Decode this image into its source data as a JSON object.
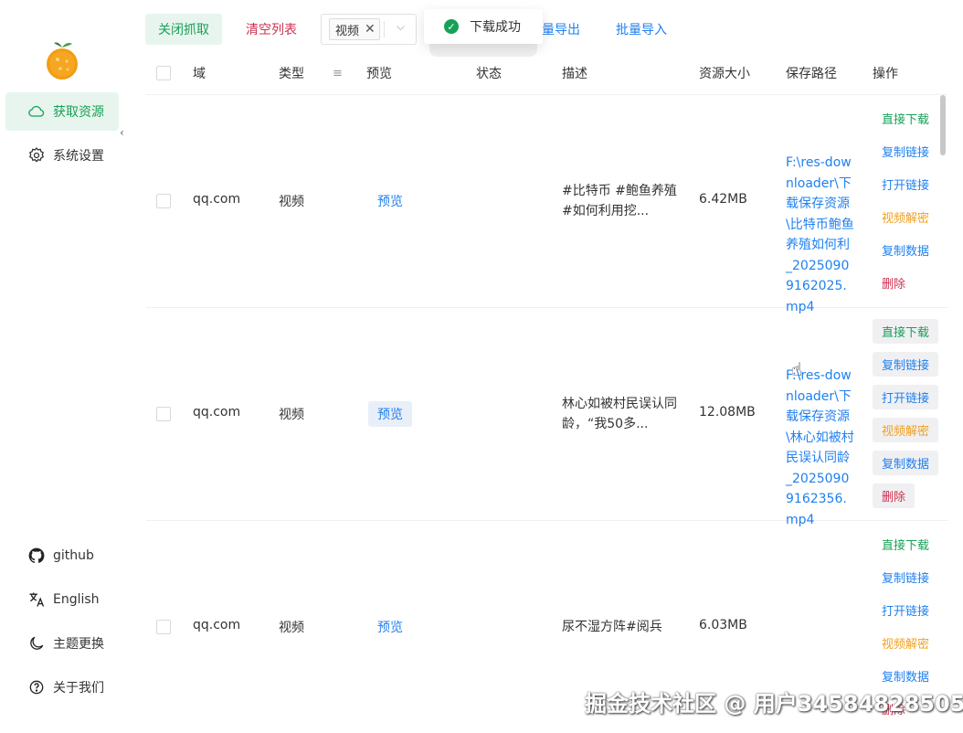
{
  "colors": {
    "accent": "#18a058",
    "link": "#2080f0",
    "warn": "#f0a020",
    "danger": "#d03050",
    "close": "#ff5f57",
    "min": "#febc2e",
    "max": "#28c840"
  },
  "sidebar": {
    "items": [
      {
        "label": "获取资源",
        "icon": "cloud-icon",
        "active": true
      },
      {
        "label": "系统设置",
        "icon": "gear-icon"
      }
    ],
    "bottom": [
      {
        "label": "github",
        "icon": "github-icon"
      },
      {
        "label": "English",
        "icon": "translate-icon"
      },
      {
        "label": "主题更换",
        "icon": "moon-icon"
      },
      {
        "label": "关于我们",
        "icon": "help-icon"
      }
    ]
  },
  "toolbar": {
    "close_capture": "关闭抓取",
    "clear_list": "清空列表",
    "filter_tag": "视频",
    "batch_export": "量导出",
    "batch_import": "批量导入"
  },
  "toast": {
    "text": "下载成功"
  },
  "table": {
    "headers": {
      "domain": "域",
      "type": "类型",
      "preview": "预览",
      "status": "状态",
      "desc": "描述",
      "size": "资源大小",
      "path": "保存路径",
      "ops": "操作"
    },
    "rows": [
      {
        "domain": "qq.com",
        "type": "视频",
        "preview": "预览",
        "desc": "#比特币 #鲍鱼养殖 #如何利用挖...",
        "size": "6.42MB",
        "path": "F:\\res-downloader\\下载保存资源\\比特币鲍鱼养殖如何利_20250909162025.mp4"
      },
      {
        "domain": "qq.com",
        "type": "视频",
        "preview": "预览",
        "desc": "林心如被村民误认同龄，“我50多...",
        "size": "12.08MB",
        "path": "F:\\res-downloader\\下载保存资源\\林心如被村民误认同龄_20250909162356.mp4"
      },
      {
        "domain": "qq.com",
        "type": "视频",
        "preview": "预览",
        "desc": "尿不湿方阵#阅兵",
        "size": "6.03MB",
        "path": ""
      }
    ],
    "ops": [
      "直接下载",
      "复制链接",
      "打开链接",
      "视频解密",
      "复制数据",
      "删除"
    ]
  },
  "watermark": "掘金技术社区 @ 用户3458482850​5"
}
